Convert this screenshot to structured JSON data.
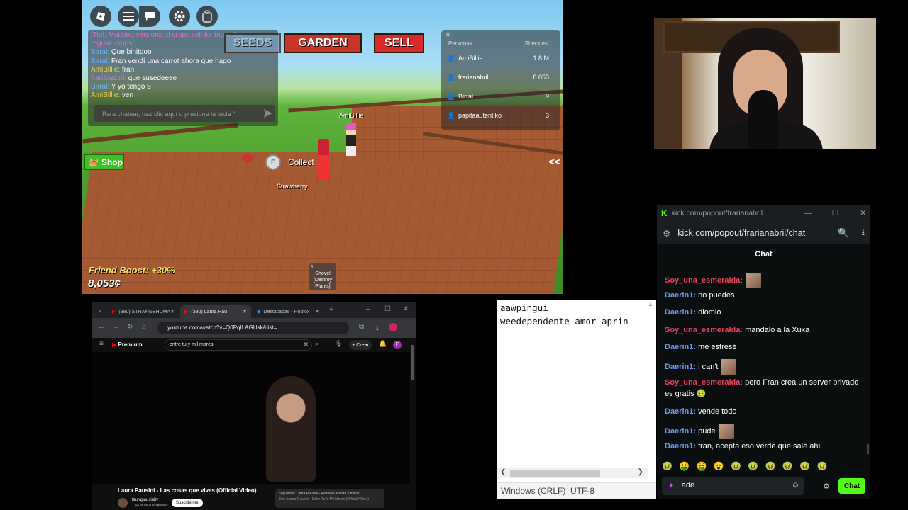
{
  "game": {
    "seeds_label": "SEEDS",
    "garden_label": "GARDEN",
    "sell_label": "SELL",
    "shop_label": "Shop",
    "collect_key": "E",
    "collect_label": "Collect",
    "crop_label": "Strawberry",
    "player_name": "AmiBillie",
    "friend_boost": "Friend Boost: +30%",
    "currency": "8,053¢",
    "toggle_label": "<<",
    "tool_slot": "1",
    "tool_label": "Shovel [Destroy Plants]",
    "chat": {
      "messages": [
        {
          "user": "",
          "text": "[Tip]: Mutated versions of crops sell for more than",
          "color": "#e56ad3"
        },
        {
          "user": "",
          "text": "regular crops!",
          "color": "#e56ad3"
        },
        {
          "user": "Birral:",
          "text": " Que binitooo",
          "color": "#6ab8ff"
        },
        {
          "user": "Birral:",
          "text": " Fran vendí una carrot ahora que hago",
          "color": "#6ab8ff"
        },
        {
          "user": "AmiBillie:",
          "text": " fran",
          "color": "#f5d04a"
        },
        {
          "user": "frarianabril:",
          "text": " que susedeeee",
          "color": "#c07bf2"
        },
        {
          "user": "Birral:",
          "text": " Y yo tengo 9",
          "color": "#6ab8ff"
        },
        {
          "user": "AmiBillie:",
          "text": " ven",
          "color": "#f5d04a"
        }
      ],
      "placeholder": "Para chatear, haz clic aquí o presiona la tecla \""
    },
    "leaderboard": {
      "col_people": "Personas",
      "col_value": "Sheckles",
      "rows": [
        {
          "name": "AmiBillie",
          "value": "1.8 M"
        },
        {
          "name": "frarianabril",
          "value": "8.053"
        },
        {
          "name": "Birral",
          "value": "9"
        },
        {
          "name": "papitaautentiko",
          "value": "3"
        }
      ]
    }
  },
  "kick": {
    "window_title": "kick.com/popout/frarianabril...",
    "url": "kick.com/popout/frarianabril/chat",
    "chat_title": "Chat",
    "messages": [
      {
        "user": "Soy_una_esmeralda:",
        "text": "",
        "color": "#e8435a",
        "emote": true
      },
      {
        "user": "Daerin1:",
        "text": " no puedes",
        "color": "#6f9cf0",
        "emote": false
      },
      {
        "user": "Daerin1:",
        "text": " diomio",
        "color": "#6f9cf0",
        "emote": false
      },
      {
        "user": "Soy_una_esmeralda:",
        "text": " mandalo a la Xuxa",
        "color": "#e8435a",
        "emote": false
      },
      {
        "user": "Daerin1:",
        "text": " me estresé",
        "color": "#6f9cf0",
        "emote": false
      },
      {
        "user": "Daerin1:",
        "text": " i can't",
        "color": "#6f9cf0",
        "emote": true
      },
      {
        "user": "Soy_una_esmeralda:",
        "text": " pero Fran crea un server privado es gratis 🤢",
        "color": "#e8435a",
        "emote": false
      },
      {
        "user": "Daerin1:",
        "text": " vende todo",
        "color": "#6f9cf0",
        "emote": false
      },
      {
        "user": "Daerin1:",
        "text": " pude",
        "color": "#6f9cf0",
        "emote": true
      },
      {
        "user": "Daerin1:",
        "text": " fran, acepta eso verde que salé ahí",
        "color": "#6f9cf0",
        "emote": false
      }
    ],
    "emote_bar": "🤢 🤑 🤮 😵 🤢 🤢 🤢 🤢 🤢 🤢",
    "input_value": "ade",
    "send_label": "Chat"
  },
  "editor": {
    "line1": "aawpingui",
    "line2": "weedependente-amor aprin",
    "encoding": "Windows (CRLF)  UTF-8"
  },
  "browser": {
    "tab1": "(380) STRANGEHUMA",
    "tab2": "(380) Laura Pau",
    "tab3": "Destacadas - Roblox",
    "url": "youtube.com/watch?v=Q0PqILAGUsk&list=...",
    "yt_brand": "Premium",
    "search_value": "entre tu y mil mares",
    "create_label": "Crear",
    "video_title": "Laura Pausini - Las cosas que vives (Official Video)",
    "channel": "laurapausinitv",
    "subs": "1,44 M de suscriptores",
    "subscribe": "Suscribirme",
    "next_label": "Siguiente: Laura Pausini - Resta in ascolto (Official ...",
    "mix_label": "Mix: Laura Pausini - Entre Tu Y Mil Mares (Official Video)",
    "avatar_letter": "F"
  }
}
